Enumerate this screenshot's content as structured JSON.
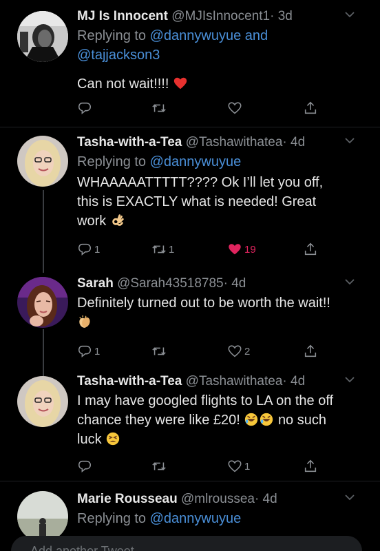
{
  "tweets": [
    {
      "name": "MJ Is Innocent",
      "handle": "@MJIsInnocent1",
      "time": "· 3d",
      "reply_prefix": "Replying to",
      "reply_to": "@dannywuyue and",
      "reply_to_2": "@tajjackson3",
      "text": "Can not wait!!!!",
      "emoji": "red-heart",
      "reply_count": "",
      "retweet_count": "",
      "like_count": ""
    },
    {
      "name": "Tasha-with-a-Tea",
      "handle": "@Tashawithatea",
      "time": "· 4d",
      "reply_prefix": "Replying to",
      "reply_to": "@dannywuyue",
      "text_lines": [
        "WHAAAAATTTTT???? Ok I’ll let you off,",
        "this is EXACTLY what is needed! Great",
        "work"
      ],
      "emoji": "ok-hand",
      "reply_count": "1",
      "retweet_count": "1",
      "like_count": "19",
      "liked": true
    },
    {
      "name": "Sarah",
      "handle": "@Sarah43518785",
      "time": "· 4d",
      "text": "Definitely turned out to be worth the wait!!",
      "emoji": "clapping-hands",
      "reply_count": "1",
      "retweet_count": "",
      "like_count": "2"
    },
    {
      "name": "Tasha-with-a-Tea",
      "handle": "@Tashawithatea",
      "time": "· 4d",
      "text_lines": [
        "I may have googled flights to LA on the off",
        "chance they were like £20!",
        "no such",
        "luck"
      ],
      "emoji": "rofl-tired",
      "reply_count": "",
      "retweet_count": "",
      "like_count": "1"
    },
    {
      "name": "Marie Rousseau",
      "handle": "@mlroussea",
      "time": "· 4d",
      "reply_prefix": "Replying to",
      "reply_to": "@dannywuyue"
    }
  ],
  "compose": {
    "placeholder": "Add another Tweet"
  },
  "colors": {
    "background": "#000000",
    "link": "#4a8fd8",
    "like": "#e0245e",
    "muted": "#8b8f94"
  }
}
